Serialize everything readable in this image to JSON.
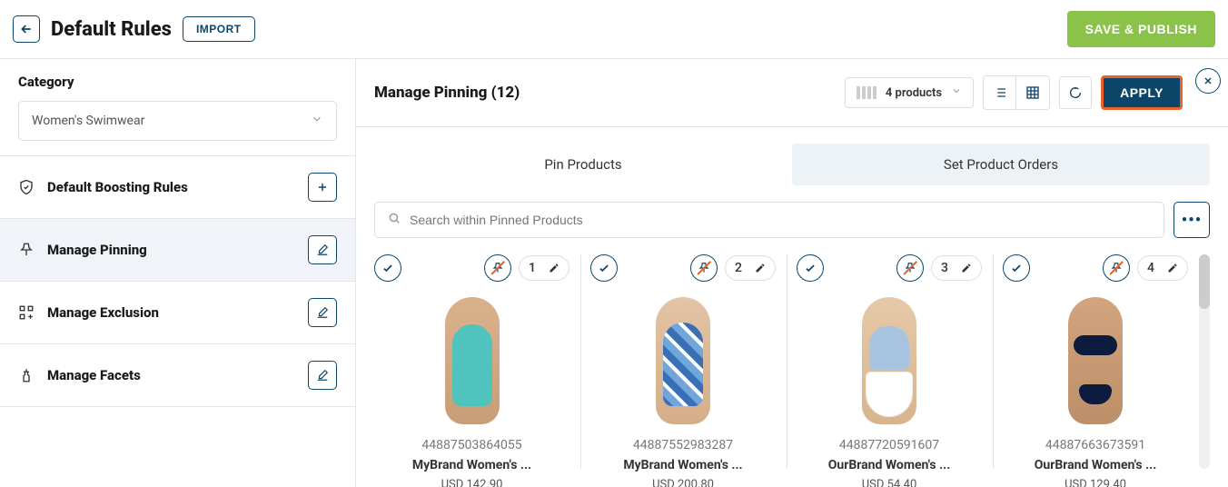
{
  "header": {
    "title": "Default Rules",
    "import_label": "IMPORT",
    "save_label": "SAVE & PUBLISH"
  },
  "sidebar": {
    "category_label": "Category",
    "selected_category": "Women's Swimwear",
    "items": [
      {
        "label": "Default Boosting Rules",
        "action": "plus"
      },
      {
        "label": "Manage Pinning",
        "action": "edit",
        "active": true
      },
      {
        "label": "Manage Exclusion",
        "action": "edit"
      },
      {
        "label": "Manage Facets",
        "action": "edit"
      }
    ]
  },
  "main": {
    "title": "Manage Pinning (12)",
    "products_select": "4 products",
    "apply_label": "APPLY",
    "tabs": [
      {
        "label": "Pin Products",
        "active": false
      },
      {
        "label": "Set Product Orders",
        "active": true
      }
    ],
    "search_placeholder": "Search within Pinned Products",
    "products": [
      {
        "rank": "1",
        "sku": "44887503864055",
        "name": "MyBrand Women's ...",
        "price": "USD 142.90"
      },
      {
        "rank": "2",
        "sku": "44887552983287",
        "name": "MyBrand Women's ...",
        "price": "USD 200.80"
      },
      {
        "rank": "3",
        "sku": "44887720591607",
        "name": "OurBrand Women's ...",
        "price": "USD 54.40"
      },
      {
        "rank": "4",
        "sku": "44887663673591",
        "name": "OurBrand Women's ...",
        "price": "USD 129.40"
      }
    ]
  },
  "colors": {
    "brand": "#0b4668",
    "accent": "#e8622a",
    "success": "#8bc34a"
  }
}
